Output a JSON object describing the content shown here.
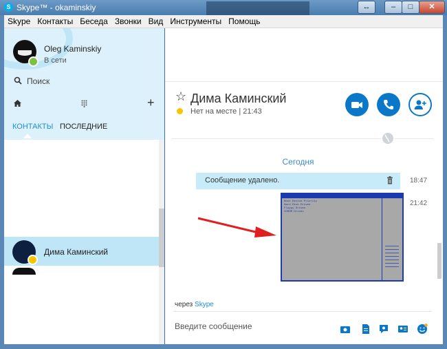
{
  "window": {
    "title": "Skype™ - okaminskiy",
    "logo_letter": "S"
  },
  "menu": [
    "Skype",
    "Контакты",
    "Беседа",
    "Звонки",
    "Вид",
    "Инструменты",
    "Помощь"
  ],
  "profile": {
    "name": "Oleg Kaminskiy",
    "status": "В сети"
  },
  "search": {
    "placeholder": "Поиск"
  },
  "tabs": {
    "contacts": "КОНТАКТЫ",
    "recent": "ПОСЛЕДНИЕ"
  },
  "contact": {
    "name": "Дима Каминский"
  },
  "conversation": {
    "name": "Дима Каминский",
    "status": "Нет на месте",
    "time": "21:43",
    "date_separator": "Сегодня",
    "messages": [
      {
        "text": "Сообщение удалено.",
        "time": "18:47"
      },
      {
        "time": "21:42"
      }
    ],
    "via_prefix": "через",
    "via_app": "Skype",
    "input_placeholder": "Введите сообщение"
  },
  "bios_image": {
    "lines": [
      "Boot Device Priority",
      "Hard Disk Drives",
      "Floppy Drives",
      "CDROM Drives"
    ]
  },
  "colors": {
    "accent": "#0a77c9",
    "sidebar": "#dcf1fb",
    "online": "#7cc242",
    "away": "#f7c600",
    "arrow": "#e02020"
  }
}
